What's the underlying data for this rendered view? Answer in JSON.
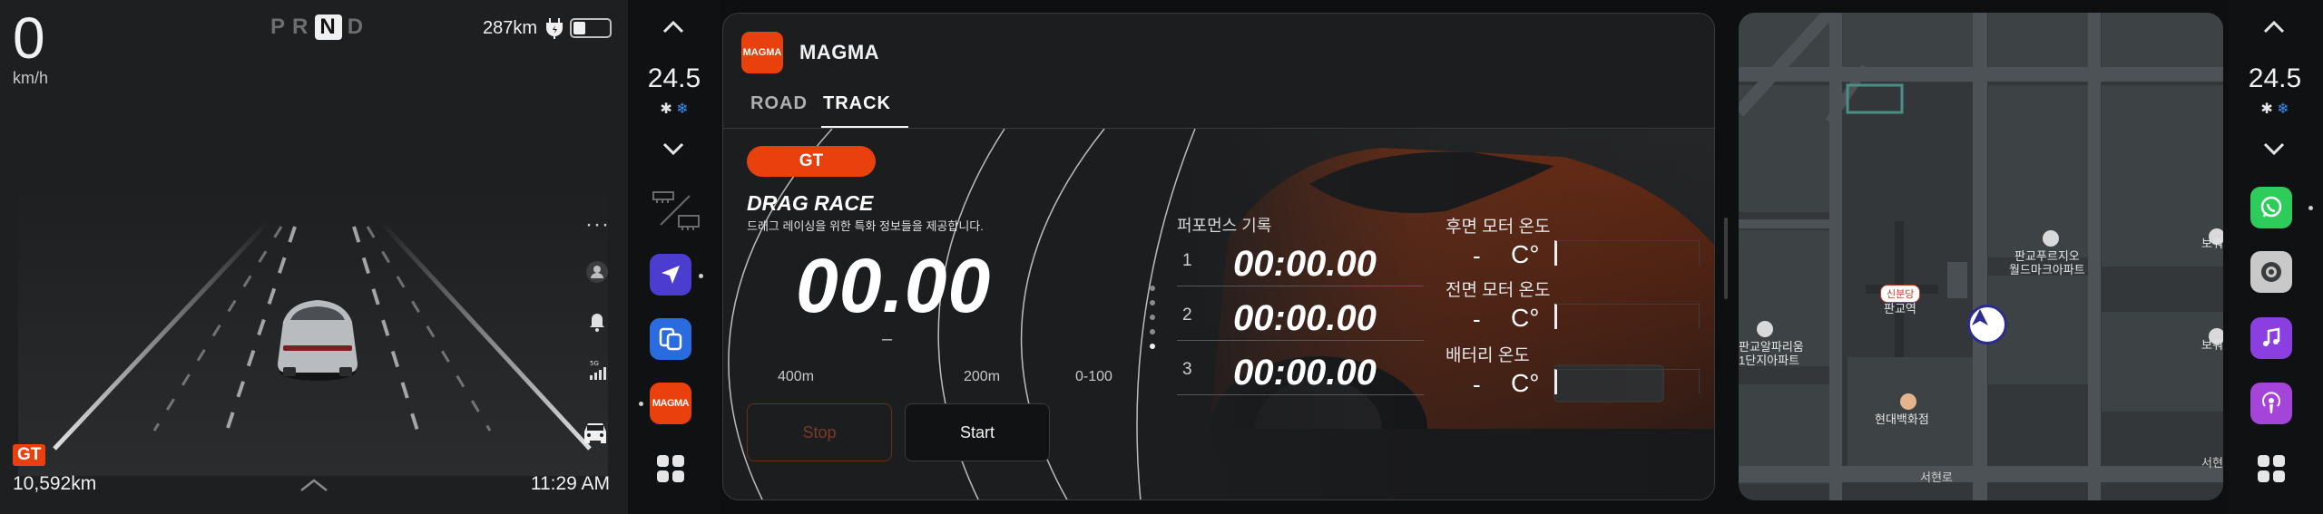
{
  "cluster": {
    "speed": "0",
    "speed_unit": "km/h",
    "gears": [
      "P",
      "R",
      "N",
      "D"
    ],
    "active_gear": "N",
    "range": "287km",
    "battery_level": 0.4,
    "menu_dots": "···",
    "mode_badge": "GT",
    "odometer": "10,592km",
    "clock": "11:29 AM"
  },
  "climate": {
    "left_temp": "24.5",
    "right_temp": "24.5",
    "fan_glyph": "✱ ❄"
  },
  "app": {
    "logo_text": "MAGMA",
    "title": "MAGMA",
    "tabs": [
      "ROAD",
      "TRACK"
    ],
    "active_tab": "TRACK"
  },
  "drag": {
    "mode_pill": "GT",
    "title": "DRAG RACE",
    "description": "드래그 레이싱을 위한 특화 정보들을 제공합니다.",
    "timer": "00.00",
    "timer_sub": "–",
    "distances": [
      "400m",
      "200m",
      "0-100"
    ],
    "stop_label": "Stop",
    "start_label": "Start"
  },
  "performance": {
    "title": "퍼포먼스 기록",
    "records": [
      {
        "index": "1",
        "time": "00:00.00"
      },
      {
        "index": "2",
        "time": "00:00.00"
      },
      {
        "index": "3",
        "time": "00:00.00"
      }
    ]
  },
  "temps": [
    {
      "label": "후면 모터 온도",
      "value": "-",
      "unit": "C°"
    },
    {
      "label": "전면 모터 온도",
      "value": "-",
      "unit": "C°"
    },
    {
      "label": "배터리 온도",
      "value": "-",
      "unit": "C°"
    }
  ],
  "map": {
    "labels": {
      "station": "신분당",
      "pangyo_station": "판교역",
      "pangyo_square": "판교푸르지오\n월드마크아파트",
      "alpha_dome": "판교알파리움\n1단지아파트",
      "hyundai": "현대백화점",
      "road": "서현로",
      "edge_top": "보워",
      "edge_mid": "보워",
      "edge_bottom": "서현"
    }
  },
  "colors": {
    "accent": "#e9400d",
    "panel": "#1c1d1f",
    "map_road": "#4a4f53"
  }
}
